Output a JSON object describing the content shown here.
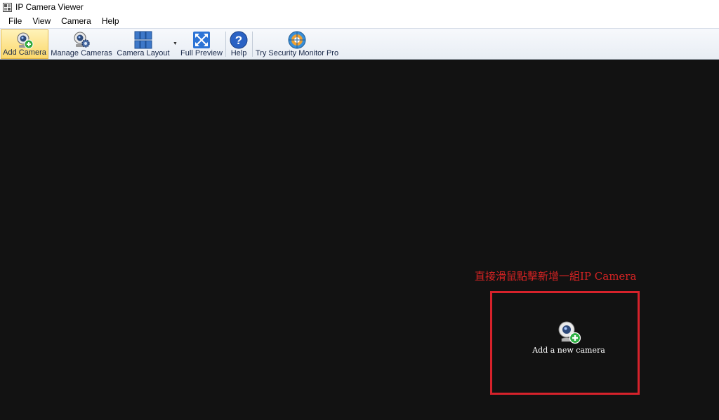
{
  "window": {
    "title": "IP Camera Viewer"
  },
  "menu": [
    "File",
    "View",
    "Camera",
    "Help"
  ],
  "toolbar": {
    "add_camera": "Add Camera",
    "manage_cameras": "Manage Cameras",
    "camera_layout": "Camera Layout",
    "full_preview": "Full Preview",
    "help": "Help",
    "try_pro": "Try Security Monitor Pro"
  },
  "main": {
    "annotation": "直接滑鼠點擊新增一組IP Camera",
    "add_slot_label": "Add a new camera"
  },
  "colors": {
    "annotation": "#d42323",
    "highlight_border": "#d6222b",
    "background": "#121212",
    "active_button": "#fbd86b"
  }
}
